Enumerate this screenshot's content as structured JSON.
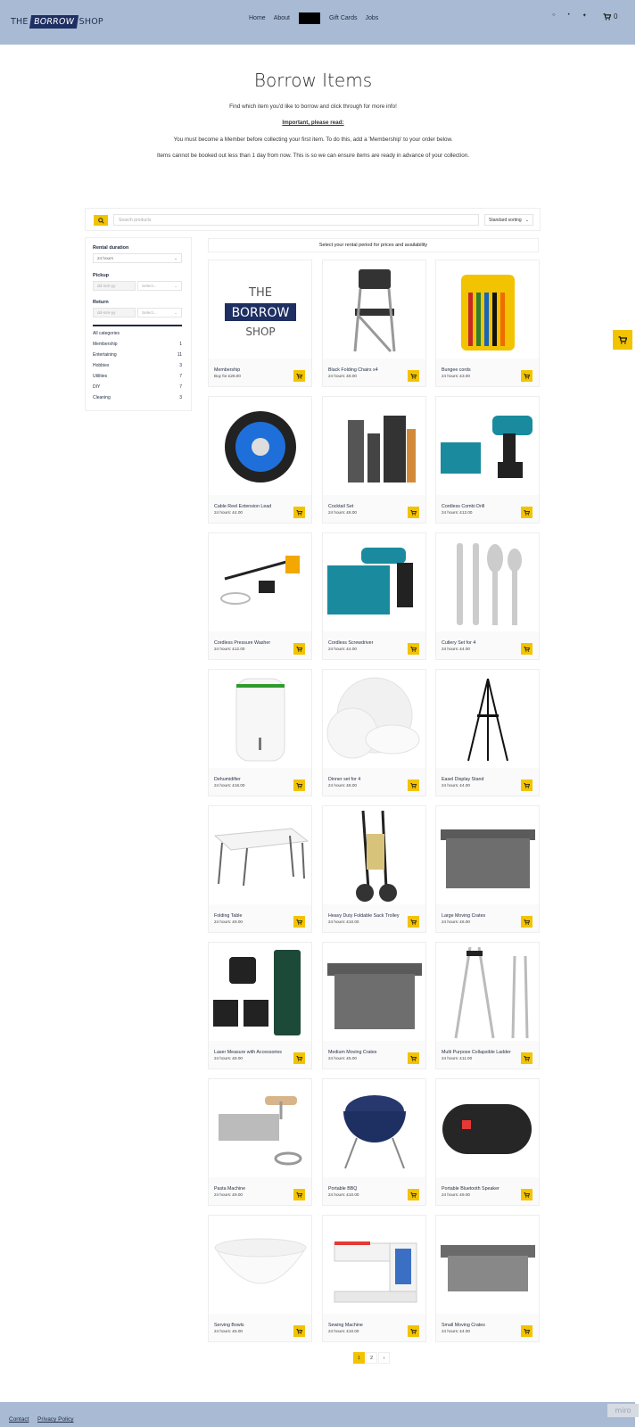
{
  "header": {
    "logo": {
      "pre": "THE",
      "highlight": "BORROW",
      "post": "SHOP"
    },
    "nav": [
      "Home",
      "About",
      "Gift Cards",
      "Jobs"
    ],
    "cart_count": "0"
  },
  "hero": {
    "title": "Borrow Items",
    "line1": "Find which item you'd like to borrow and click through for more info!",
    "important": "Important, please read:",
    "line2": "You must become a Member before collecting your first item. To do this, add a 'Membership' to your order below.",
    "line3": "Items cannot be booked out less than 1 day from now. This is so we can ensure items are ready in advance of your collection."
  },
  "search": {
    "placeholder": "Search products",
    "sort": "Standard sorting"
  },
  "sidebar": {
    "rental_label": "Rental duration",
    "rental_value": "24 hours",
    "pickup_label": "Pickup",
    "pickup_date": "dd-mm-yy",
    "pickup_select": "Select...",
    "return_label": "Return",
    "return_date": "dd-mm-yy",
    "return_select": "Select...",
    "all_categories": "All categories",
    "categories": [
      {
        "name": "Membership",
        "count": "1"
      },
      {
        "name": "Entertaining",
        "count": "11"
      },
      {
        "name": "Hobbies",
        "count": "3"
      },
      {
        "name": "Utilities",
        "count": "7"
      },
      {
        "name": "DIY",
        "count": "7"
      },
      {
        "name": "Cleaning",
        "count": "3"
      }
    ]
  },
  "rental_message": "Select your rental period for prices and availability",
  "products": [
    {
      "name": "Membership",
      "price": "Buy for £28.00"
    },
    {
      "name": "Black Folding Chairs x4",
      "price": "24 hours: £8.00"
    },
    {
      "name": "Bungee cords",
      "price": "24 hours: £3.00"
    },
    {
      "name": "Cable Reel Extension Lead",
      "price": "24 hours: £4.00"
    },
    {
      "name": "Cocktail Set",
      "price": "24 hours: £8.00"
    },
    {
      "name": "Cordless Combi Drill",
      "price": "24 hours: £12.00"
    },
    {
      "name": "Cordless Pressure Washer",
      "price": "24 hours: £12.00"
    },
    {
      "name": "Cordless Screwdriver",
      "price": "24 hours: £4.00"
    },
    {
      "name": "Cutlery Set for 4",
      "price": "24 hours: £4.00"
    },
    {
      "name": "Dehumidifier",
      "price": "24 hours: £16.00"
    },
    {
      "name": "Dinner set for 4",
      "price": "24 hours: £8.00"
    },
    {
      "name": "Easel Display Stand",
      "price": "24 hours: £4.00"
    },
    {
      "name": "Folding Table",
      "price": "24 hours: £9.00"
    },
    {
      "name": "Heavy Duty Foldable Sack Trolley",
      "price": "24 hours: £10.00"
    },
    {
      "name": "Large Moving Crates",
      "price": "24 hours: £6.00"
    },
    {
      "name": "Laser Measure with Accessories",
      "price": "24 hours: £8.00"
    },
    {
      "name": "Medium Moving Crates",
      "price": "24 hours: £5.00"
    },
    {
      "name": "Multi Purpose Collapsible Ladder",
      "price": "24 hours: £11.00"
    },
    {
      "name": "Pasta Machine",
      "price": "24 hours: £9.00"
    },
    {
      "name": "Portable BBQ",
      "price": "24 hours: £10.00"
    },
    {
      "name": "Portable Bluetooth Speaker",
      "price": "24 hours: £9.00"
    },
    {
      "name": "Serving Bowls",
      "price": "24 hours: £6.00"
    },
    {
      "name": "Sewing Machine",
      "price": "24 hours: £10.00"
    },
    {
      "name": "Small Moving Crates",
      "price": "24 hours: £4.00"
    }
  ],
  "pagination": {
    "current": "1",
    "next_page": "2",
    "next_icon": "chevron-right-icon"
  },
  "footer": {
    "contact": "Contact",
    "privacy": "Privacy Policy",
    "badge": "miro"
  },
  "colors": {
    "header_bg": "#a9bbd4",
    "accent": "#f2c300",
    "brand_dark": "#1e2f62"
  }
}
